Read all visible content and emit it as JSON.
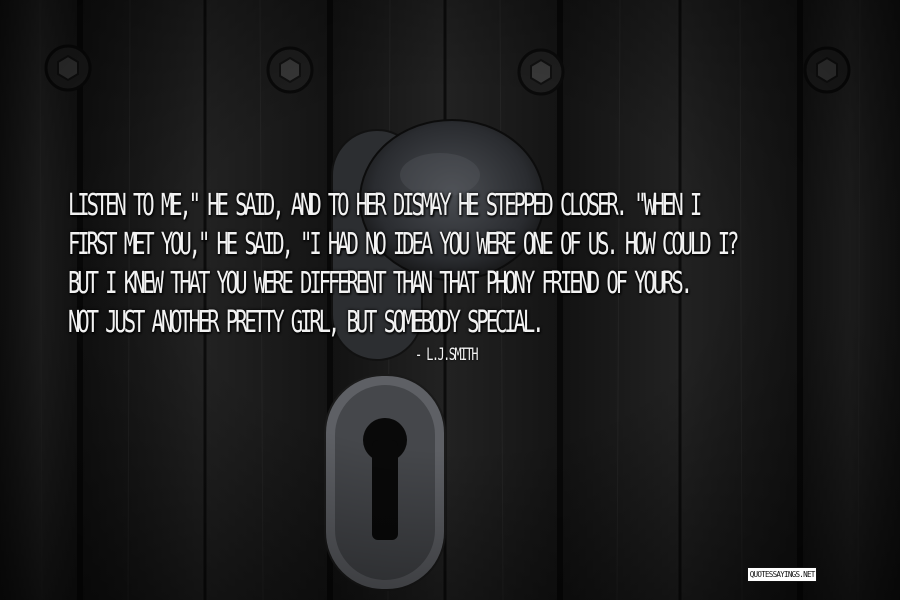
{
  "quote": {
    "lines": [
      "LISTEN TO ME,\" HE SAID, AND TO HER DISMAY HE STEPPED CLOSER. \"WHEN I",
      "FIRST MET YOU,\" HE SAID, \"I HAD NO IDEA YOU WERE ONE OF US. HOW COULD I?",
      "BUT I KNEW THAT YOU WERE DIFFERENT THAN THAT PHONY FRIEND OF YOURS.",
      "NOT JUST ANOTHER PRETTY GIRL, BUT SOMEBODY SPECIAL."
    ],
    "author": "- L.J.SMITH"
  },
  "watermark": {
    "text": "QUOTESSAYINGS.NET"
  },
  "colors": {
    "text": "#f2f2f2",
    "background": "#1a1a1a"
  },
  "icons": [
    "bolt-icon",
    "door-handle-icon",
    "keyhole-icon"
  ]
}
